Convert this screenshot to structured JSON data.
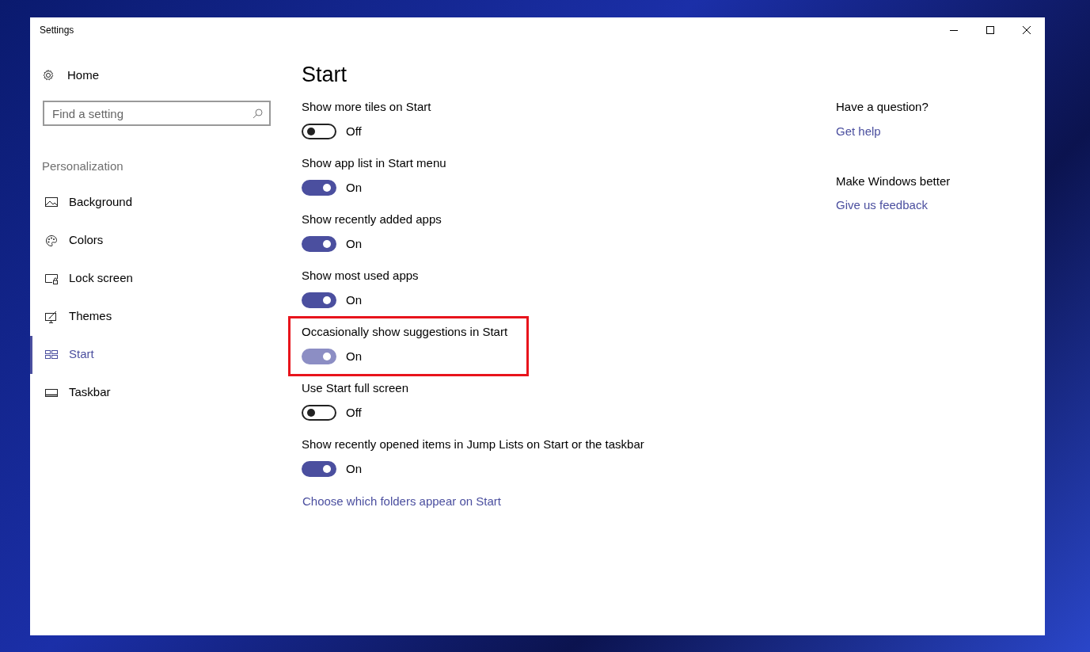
{
  "window": {
    "title": "Settings"
  },
  "sidebar": {
    "home": "Home",
    "search": {
      "placeholder": "Find a setting"
    },
    "section": "Personalization",
    "items": [
      {
        "label": "Background",
        "selected": false
      },
      {
        "label": "Colors",
        "selected": false
      },
      {
        "label": "Lock screen",
        "selected": false
      },
      {
        "label": "Themes",
        "selected": false
      },
      {
        "label": "Start",
        "selected": true
      },
      {
        "label": "Taskbar",
        "selected": false
      }
    ]
  },
  "page": {
    "title": "Start",
    "settings": [
      {
        "label": "Show more tiles on Start",
        "on": false,
        "state": "Off",
        "highlighted": false
      },
      {
        "label": "Show app list in Start menu",
        "on": true,
        "state": "On",
        "highlighted": false
      },
      {
        "label": "Show recently added apps",
        "on": true,
        "state": "On",
        "highlighted": false
      },
      {
        "label": "Show most used apps",
        "on": true,
        "state": "On",
        "highlighted": false
      },
      {
        "label": "Occasionally show suggestions in Start",
        "on": true,
        "state": "On",
        "highlighted": true
      },
      {
        "label": "Use Start full screen",
        "on": false,
        "state": "Off",
        "highlighted": false
      },
      {
        "label": "Show recently opened items in Jump Lists on Start or the taskbar",
        "on": true,
        "state": "On",
        "highlighted": false
      }
    ],
    "link": "Choose which folders appear on Start"
  },
  "help": [
    {
      "heading": "Have a question?",
      "link": "Get help"
    },
    {
      "heading": "Make Windows better",
      "link": "Give us feedback"
    }
  ]
}
